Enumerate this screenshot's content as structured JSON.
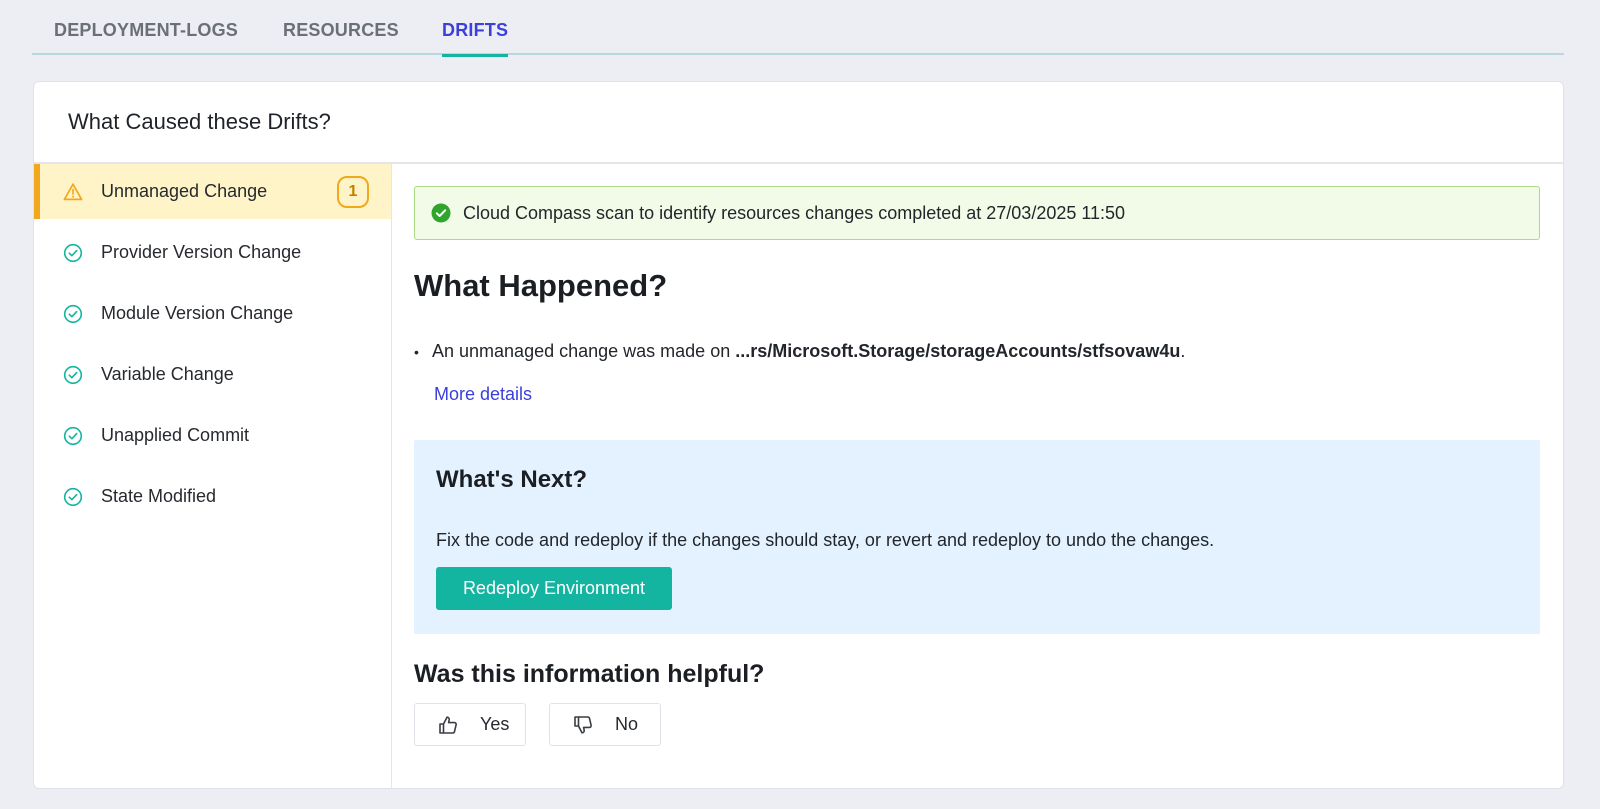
{
  "tabs": [
    {
      "label": "DEPLOYMENT-LOGS",
      "active": false
    },
    {
      "label": "RESOURCES",
      "active": false
    },
    {
      "label": "DRIFTS",
      "active": true
    }
  ],
  "card": {
    "title": "What Caused these Drifts?"
  },
  "sidebar": {
    "items": [
      {
        "label": "Unmanaged Change",
        "icon": "warning-icon",
        "status": "warning",
        "badge": "1"
      },
      {
        "label": "Provider Version Change",
        "icon": "check-circle-icon",
        "status": "ok"
      },
      {
        "label": "Module Version Change",
        "icon": "check-circle-icon",
        "status": "ok"
      },
      {
        "label": "Variable Change",
        "icon": "check-circle-icon",
        "status": "ok"
      },
      {
        "label": "Unapplied Commit",
        "icon": "check-circle-icon",
        "status": "ok"
      },
      {
        "label": "State Modified",
        "icon": "check-circle-icon",
        "status": "ok"
      }
    ]
  },
  "main": {
    "scan_banner": "Cloud Compass scan to identify resources changes completed at 27/03/2025 11:50",
    "what_happened": {
      "title": "What Happened?",
      "bullet_prefix": "An unmanaged change was made on ",
      "bullet_path": "...rs/Microsoft.Storage/storageAccounts/stfsovaw4u",
      "bullet_suffix": ".",
      "more_link": "More details"
    },
    "whats_next": {
      "title": "What's Next?",
      "text": "Fix the code and redeploy if the changes should stay, or revert and redeploy to undo the changes.",
      "button": "Redeploy Environment"
    },
    "feedback": {
      "title": "Was this information helpful?",
      "yes": "Yes",
      "no": "No"
    }
  },
  "colors": {
    "accent": "#13b5a0",
    "link": "#3b3fdb",
    "warning": "#f2a81d",
    "success": "#2fa52b"
  }
}
